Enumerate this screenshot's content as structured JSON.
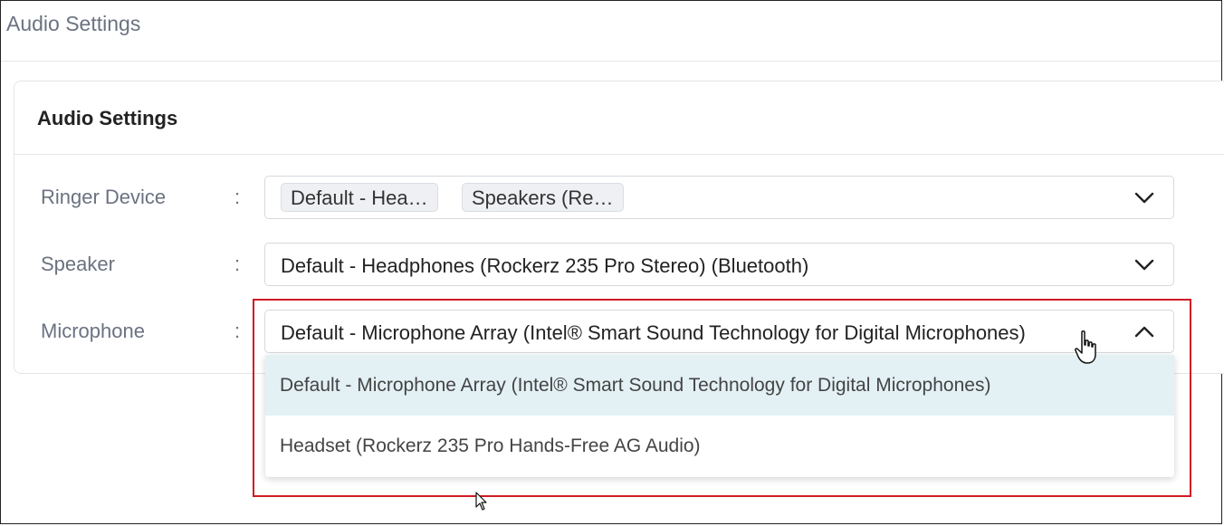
{
  "header": {
    "title": "Audio Settings"
  },
  "card": {
    "title": "Audio Settings"
  },
  "separator": ":",
  "ringer": {
    "label": "Ringer Device",
    "chips": [
      "Default - Hea…",
      "Speakers (Re…"
    ]
  },
  "speaker": {
    "label": "Speaker",
    "value": "Default - Headphones (Rockerz 235 Pro Stereo) (Bluetooth)"
  },
  "microphone": {
    "label": "Microphone",
    "value": "Default - Microphone Array (Intel® Smart Sound Technology for Digital Microphones)",
    "options": [
      "Default - Microphone Array (Intel® Smart Sound Technology for Digital Microphones)",
      "Headset (Rockerz 235 Pro Hands-Free AG Audio)"
    ]
  },
  "icons": {
    "chevron_down": "chevron-down-icon",
    "chevron_up": "chevron-up-icon",
    "hand_cursor": "hand-pointer-icon",
    "arrow_cursor": "arrow-pointer-icon"
  },
  "colors": {
    "highlight_border": "#d01c24",
    "selected_option_bg": "#e3f1f5"
  }
}
